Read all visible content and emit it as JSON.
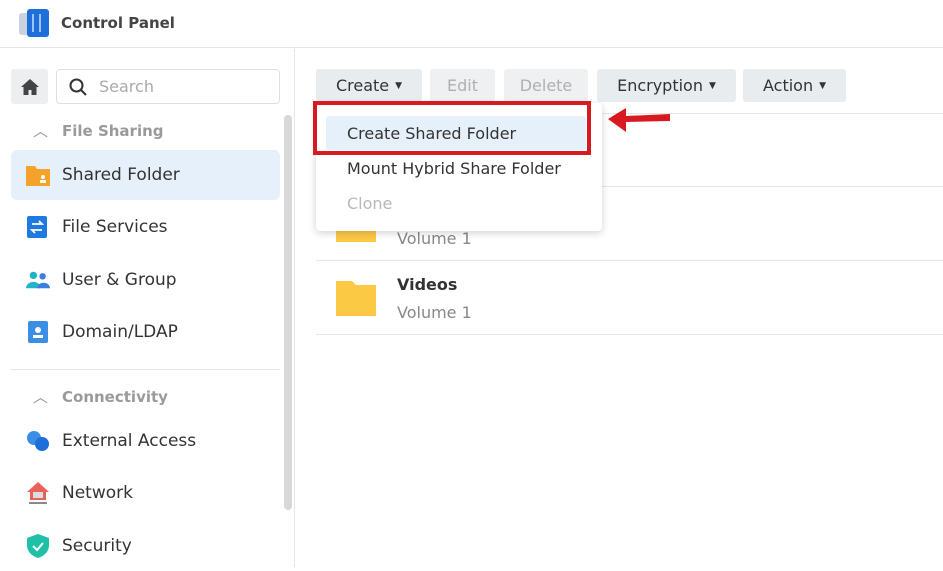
{
  "window": {
    "title": "Control Panel"
  },
  "sidebar": {
    "search_placeholder": "Search",
    "sections": [
      {
        "label": "File Sharing",
        "items": [
          {
            "label": "Shared Folder",
            "active": true
          },
          {
            "label": "File Services"
          },
          {
            "label": "User & Group"
          },
          {
            "label": "Domain/LDAP"
          }
        ]
      },
      {
        "label": "Connectivity",
        "items": [
          {
            "label": "External Access"
          },
          {
            "label": "Network"
          },
          {
            "label": "Security"
          }
        ]
      }
    ]
  },
  "toolbar": {
    "create": "Create",
    "edit": "Edit",
    "delete": "Delete",
    "encryption": "Encryption",
    "action": "Action"
  },
  "create_menu": {
    "items": [
      {
        "label": "Create Shared Folder",
        "highlighted": true
      },
      {
        "label": "Mount Hybrid Share Folder"
      },
      {
        "label": "Clone",
        "disabled": true
      }
    ]
  },
  "folders": [
    {
      "name": "",
      "volume": ""
    },
    {
      "name": "",
      "volume": "Volume 1"
    },
    {
      "name": "Videos",
      "volume": "Volume 1"
    }
  ],
  "colors": {
    "accent": "#e6f0fa",
    "annotation": "#d71920",
    "folder": "#fcc945"
  }
}
